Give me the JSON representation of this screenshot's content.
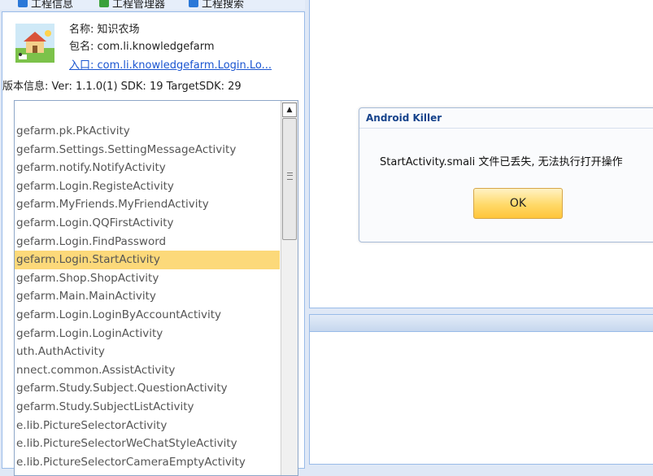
{
  "tabs": [
    {
      "label": "工程信息",
      "icon": "info-tab-icon",
      "color": "#2b78d8"
    },
    {
      "label": "工程管理器",
      "icon": "manager-tab-icon",
      "color": "#3aa13a"
    },
    {
      "label": "工程搜索",
      "icon": "search-tab-icon",
      "color": "#2b78d8"
    }
  ],
  "app_info": {
    "name_label": "名称: 知识农场",
    "package_label": "包名: com.li.knowledgefarm",
    "entry_label": "入口: com.li.knowledgefarm.Login.Lo...",
    "version_label": "版本信息: Ver: 1.1.0(1) SDK: 19 TargetSDK: 29"
  },
  "activities": [
    {
      "label": "gefarm.pk.PkActivity",
      "selected": false
    },
    {
      "label": "gefarm.Settings.SettingMessageActivity",
      "selected": false
    },
    {
      "label": "gefarm.notify.NotifyActivity",
      "selected": false
    },
    {
      "label": "gefarm.Login.RegisteActivity",
      "selected": false
    },
    {
      "label": "gefarm.MyFriends.MyFriendActivity",
      "selected": false
    },
    {
      "label": "gefarm.Login.QQFirstActivity",
      "selected": false
    },
    {
      "label": "gefarm.Login.FindPassword",
      "selected": false
    },
    {
      "label": "gefarm.Login.StartActivity",
      "selected": true
    },
    {
      "label": "gefarm.Shop.ShopActivity",
      "selected": false
    },
    {
      "label": "gefarm.Main.MainActivity",
      "selected": false
    },
    {
      "label": "gefarm.Login.LoginByAccountActivity",
      "selected": false
    },
    {
      "label": "gefarm.Login.LoginActivity",
      "selected": false
    },
    {
      "label": "uth.AuthActivity",
      "selected": false
    },
    {
      "label": "nnect.common.AssistActivity",
      "selected": false
    },
    {
      "label": "gefarm.Study.Subject.QuestionActivity",
      "selected": false
    },
    {
      "label": "gefarm.Study.SubjectListActivity",
      "selected": false
    },
    {
      "label": "e.lib.PictureSelectorActivity",
      "selected": false
    },
    {
      "label": "e.lib.PictureSelectorWeChatStyleActivity",
      "selected": false
    },
    {
      "label": "e.lib.PictureSelectorCameraEmptyActivity",
      "selected": false
    }
  ],
  "dialog": {
    "title": "Android Killer",
    "message": "StartActivity.smali 文件已丢失, 无法执行打开操作",
    "ok_label": "OK"
  },
  "colors": {
    "selection": "#fcd97a",
    "link": "#1a55d1",
    "dialog_title": "#15428b",
    "ok_button": "#ffd968"
  }
}
